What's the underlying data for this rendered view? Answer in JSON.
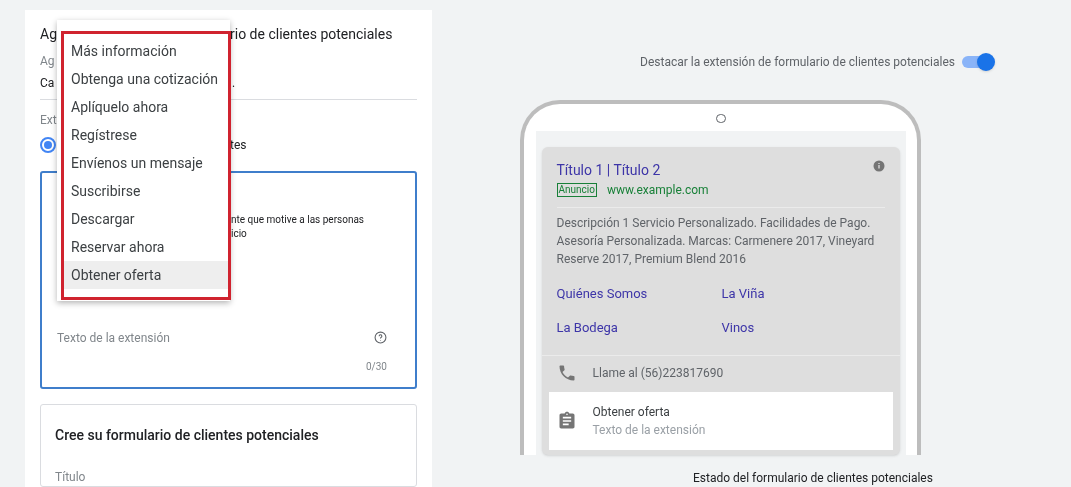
{
  "form_panel": {
    "title_fragments": [
      "Ag",
      "rio de clientes potenciales"
    ],
    "field_label_fragment": "Ag",
    "field_value_fragments": [
      "Ca",
      "."
    ],
    "section_label_fragment": "Ext",
    "radio": {
      "selected": true,
      "label_fragment": "tes"
    },
    "extension_card": {
      "description_fragments": [
        "nte que motive a las personas",
        "icio"
      ],
      "text_field": {
        "placeholder": "Texto de la extensión",
        "counter": "0/30"
      }
    },
    "form_card": {
      "title": "Cree su formulario de clientes potenciales",
      "field_label": "Título"
    }
  },
  "dropdown": {
    "items": [
      {
        "label": "Más información",
        "selected": false
      },
      {
        "label": "Obtenga una cotización",
        "selected": false
      },
      {
        "label": "Aplíquelo ahora",
        "selected": false
      },
      {
        "label": "Regístrese",
        "selected": false
      },
      {
        "label": "Envíenos un mensaje",
        "selected": false
      },
      {
        "label": "Suscribirse",
        "selected": false
      },
      {
        "label": "Descargar",
        "selected": false
      },
      {
        "label": "Reservar ahora",
        "selected": false
      },
      {
        "label": "Obtener oferta",
        "selected": true
      }
    ]
  },
  "preview": {
    "highlight_toggle": {
      "label": "Destacar la extensión de formulario de clientes potenciales",
      "on": true
    },
    "ad": {
      "headline": "Título 1 | Título 2",
      "badge": "Anuncio",
      "url": "www.example.com",
      "description": "Descripción 1 Servicio Personalizado. Facilidades de Pago. Asesoría Personalizada. Marcas: Carmenere 2017, Vineyard Reserve 2017, Premium Blend 2016",
      "sitelinks": [
        "Quiénes Somos",
        "La Viña",
        "La Bodega",
        "Vinos"
      ],
      "call": "Llame al (56)223817690",
      "lead_form": {
        "title": "Obtener oferta",
        "subtitle": "Texto de la extensión"
      }
    },
    "status_label": "Estado del formulario de clientes potenciales"
  }
}
